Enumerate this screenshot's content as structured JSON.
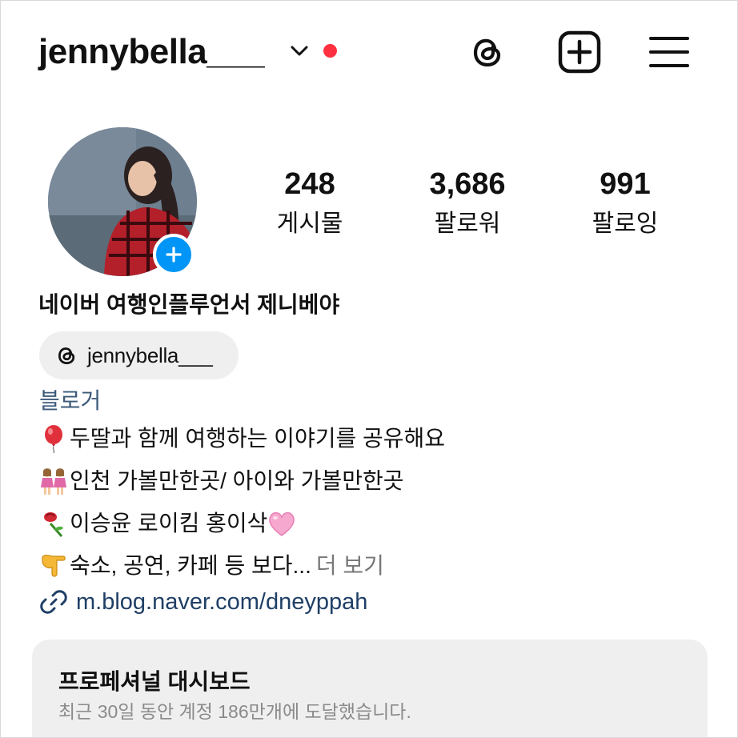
{
  "header": {
    "username": "jennybella___",
    "chevron_icon": "chevron-down-icon",
    "notification_dot_color": "#ff3040",
    "threads_icon": "threads-icon",
    "add_icon": "plus-square-icon",
    "menu_icon": "hamburger-menu-icon"
  },
  "profile": {
    "avatar_badge_icon": "plus-icon",
    "avatar_badge_color": "#0095f6",
    "stats": [
      {
        "value": "248",
        "label": "게시물"
      },
      {
        "value": "3,686",
        "label": "팔로워"
      },
      {
        "value": "991",
        "label": "팔로잉"
      }
    ]
  },
  "bio": {
    "display_name": "네이버 여행인플루언서 제니베야",
    "threads_handle": "jennybella___",
    "category": "블로거",
    "lines": [
      {
        "emoji": "balloon",
        "text": "두딸과 함께 여행하는 이야기를 공유해요"
      },
      {
        "emoji": "two-girls",
        "text": "인천 가볼만한곳/ 아이와 가볼만한곳"
      },
      {
        "emoji": "rose",
        "text": "이승윤 로이킴 홍이삭 ",
        "trailing_emoji": "pink-heart"
      },
      {
        "emoji": "pointing-down-hand",
        "text": "숙소, 공연, 카페 등 보다...",
        "more": "더 보기"
      }
    ],
    "link": "m.blog.naver.com/dneyppah",
    "link_icon": "link-icon"
  },
  "dashboard": {
    "title": "프로페셔널 대시보드",
    "subtitle": "최근 30일 동안 계정 186만개에 도달했습니다."
  },
  "colors": {
    "accent_blue": "#0095f6",
    "link_color": "#1f3f66",
    "category_color": "#3c5a7a",
    "muted_text": "#8a8a8a",
    "card_bg": "#efefef"
  }
}
